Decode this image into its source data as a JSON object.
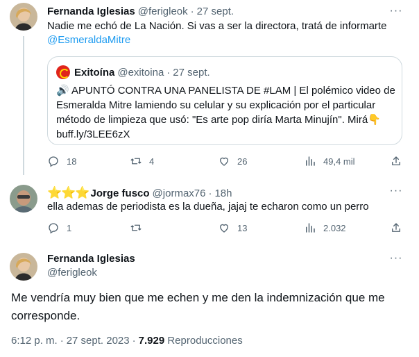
{
  "tweet1": {
    "name": "Fernanda Iglesias",
    "handle": "@ferigleok",
    "date": "27 sept.",
    "text": "Nadie me echó de La Nación. Si vas a ser la directora, tratá de informarte",
    "mention": "@EsmeraldaMitre",
    "replies": "18",
    "retweets": "4",
    "likes": "26",
    "views": "49,4 mil"
  },
  "quote": {
    "name": "Exitoína",
    "handle": "@exitoina",
    "date": "27 sept.",
    "text": "🔊 APUNTÓ CONTRA UNA PANELISTA DE #LAM | El polémico video de Esmeralda Mitre lamiendo su celular y su explicación por el particular método de limpieza que usó: \"Es arte pop diría Marta Minujín\". Mirá👇 buff.ly/3LEE6zX"
  },
  "tweet2": {
    "stars": "⭐⭐⭐",
    "name": "Jorge fusco",
    "handle": "@jormax76",
    "date": "18h",
    "text": "ella ademas de periodista es la dueña, jajaj te echaron como un perro",
    "replies": "1",
    "retweets": "",
    "likes": "13",
    "views": "2.032"
  },
  "focus": {
    "name": "Fernanda Iglesias",
    "handle": "@ferigleok",
    "text": "Me vendría muy bien que me echen y me den la indemnización que me corresponde.",
    "time": "6:12 p. m.",
    "date": "27 sept. 2023",
    "views_count": "7.929",
    "views_label": "Reproducciones"
  },
  "icons": {
    "more": "more-icon",
    "reply": "reply-icon",
    "retweet": "retweet-icon",
    "like": "heart-icon",
    "views": "analytics-icon",
    "share": "share-icon"
  },
  "colors": {
    "link": "#1d9bf0",
    "muted": "#536471",
    "text": "#0f1419",
    "border": "#cfd9de"
  }
}
